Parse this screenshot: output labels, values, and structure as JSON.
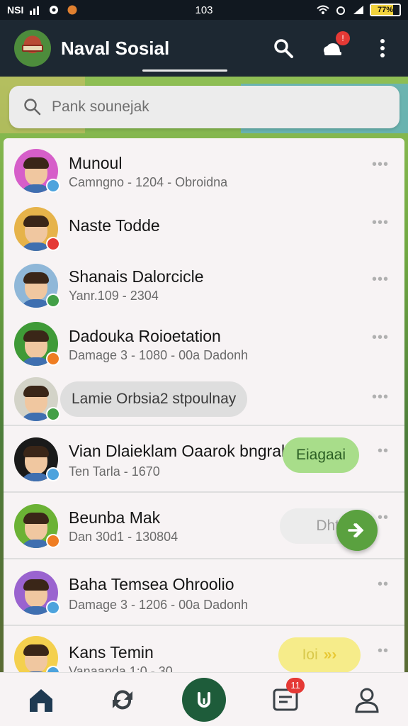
{
  "status_bar": {
    "left_text": "NSI",
    "time": "103",
    "battery_text": "77%",
    "battery_level": 0.77
  },
  "header": {
    "title": "Naval Sosial",
    "notification_badge": "!",
    "icons": [
      "search-icon",
      "notification-icon",
      "more-vert-icon"
    ]
  },
  "search": {
    "placeholder": "Pank sounejak"
  },
  "contacts": [
    {
      "name": "Munoul",
      "subtitle": "Camngno - 1204 - Obroidna",
      "status_color": "#4da3dd",
      "avatar_color": "#d65ec9",
      "more": "•••"
    },
    {
      "name": "Naste Todde",
      "subtitle": "",
      "status_color": "#e53935",
      "avatar_color": "#e6b34a",
      "more": "•••"
    },
    {
      "name": "Shanais Dalorcicle",
      "subtitle": "Yanr.109 - 2304",
      "status_color": "#43a047",
      "avatar_color": "#8fb7d8",
      "more": "•••"
    },
    {
      "name": "Dadouka Roioetation",
      "subtitle": "Damage 3 - 1080 - 00a Dadonh",
      "status_color": "#ef7d22",
      "avatar_color": "#3f9a37",
      "more": "•••"
    },
    {
      "name": "Lamie Orbsia2 stpoulnay",
      "subtitle": "",
      "status_color": "#43a047",
      "avatar_color": "#d3d3c8",
      "more": "•••"
    },
    {
      "name": "Vian Dlaieklam Oaarok bngral",
      "subtitle": "Ten Tarla - 1670",
      "status_color": "#4da3dd",
      "avatar_color": "#1a1a1a",
      "more": "••",
      "action": "Eiagaai"
    },
    {
      "name": "Beunba Mak",
      "subtitle": "Dan 30d1 - 130804",
      "status_color": "#ef7d22",
      "avatar_color": "#6bb235",
      "more": "••",
      "action": "Dhtl"
    },
    {
      "name": "Baha Temsea Ohroolio",
      "subtitle": "Damage 3 - 1206 - 00a Dadonh",
      "status_color": "#4da3dd",
      "avatar_color": "#9a63cf",
      "more": "••"
    },
    {
      "name": "Kans Temin",
      "subtitle": "Vanaanda 1:0 - 30",
      "status_color": "#4da3dd",
      "avatar_color": "#f4d04e",
      "more": "••",
      "action": "Ioi"
    }
  ],
  "bottom_nav": {
    "items": [
      "home-icon",
      "refresh-icon",
      "center-action-icon",
      "messages-icon",
      "profile-icon"
    ],
    "messages_badge": "11"
  }
}
